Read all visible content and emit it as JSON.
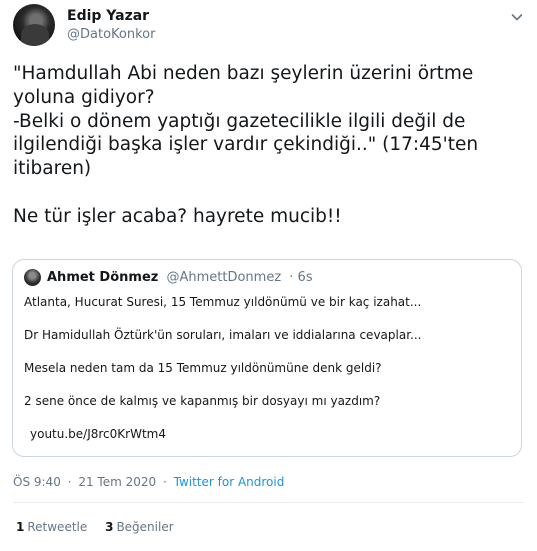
{
  "tweet": {
    "author_name": "Edip Yazar",
    "author_handle": "@DatoKonkor",
    "text": "\"Hamdullah Abi neden bazı şeylerin üzerini örtme\nyoluna gidiyor?\n-Belki o dönem yaptığı gazetecilikle ilgili değil de\nilgilendiği başka işler vardır çekindiği..\" (17:45'ten\nitibaren)\n\nNe tür işler acaba? hayrete mucib!!",
    "menu_icon": "chevron-down-icon"
  },
  "quoted": {
    "author_name": "Ahmet Dönmez",
    "author_handle": "@AhmettDonmez",
    "time": "· 6s",
    "lines": [
      "Atlanta, Hucurat Suresi, 15 Temmuz yıldönümü ve bir kaç izahat...",
      "Dr Hamidullah Öztürk'ün soruları, imaları ve iddialarına cevaplar...",
      "Mesela neden tam da 15 Temmuz yıldönümüne denk geldi?",
      "2 sene önce de kalmış ve kapanmış bir dosyayı mı yazdım?"
    ],
    "link": "youtu.be/J8rc0KrWtm4"
  },
  "meta": {
    "time": "ÖS 9:40",
    "sep1": "·",
    "date": "21 Tem 2020",
    "sep2": "·",
    "source": "Twitter for Android"
  },
  "stats": {
    "retweets_count": "1",
    "retweets_label": "Retweetle",
    "likes_count": "3",
    "likes_label": "Beğeniler"
  },
  "colors": {
    "text": "#14171a",
    "secondary": "#657786",
    "link": "#1b95e0",
    "border": "#ccd6dd"
  }
}
